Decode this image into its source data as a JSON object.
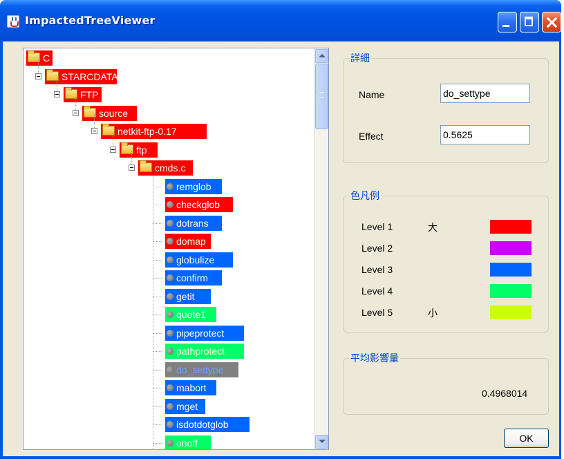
{
  "window": {
    "title": "ImpactedTreeViewer"
  },
  "colors": {
    "level1": "#ff0000",
    "level2": "#cc00ff",
    "level3": "#0066ff",
    "level4": "#00ff66",
    "level5": "#ccff00",
    "selected": "#808080",
    "selected_text": "#6fa0ff"
  },
  "tree": {
    "folders": [
      {
        "label": "C",
        "color": "level1"
      },
      {
        "label": "STARCDATA",
        "color": "level1"
      },
      {
        "label": "FTP",
        "color": "level1"
      },
      {
        "label": "source",
        "color": "level1"
      },
      {
        "label": "netkit-ftp-0.17",
        "color": "level1"
      },
      {
        "label": "ftp",
        "color": "level1"
      },
      {
        "label": "cmds.c",
        "color": "level1"
      }
    ],
    "leaves": [
      {
        "label": "remglob",
        "color": "level3"
      },
      {
        "label": "checkglob",
        "color": "level1"
      },
      {
        "label": "dotrans",
        "color": "level3"
      },
      {
        "label": "domap",
        "color": "level1"
      },
      {
        "label": "globulize",
        "color": "level3"
      },
      {
        "label": "confirm",
        "color": "level3"
      },
      {
        "label": "getit",
        "color": "level3"
      },
      {
        "label": "quote1",
        "color": "level4"
      },
      {
        "label": "pipeprotect",
        "color": "level3"
      },
      {
        "label": "pathprotect",
        "color": "level4"
      },
      {
        "label": "do_settype",
        "color": "selected",
        "selected": true
      },
      {
        "label": "mabort",
        "color": "level3"
      },
      {
        "label": "mget",
        "color": "level3"
      },
      {
        "label": "isdotdotglob",
        "color": "level3"
      },
      {
        "label": "onoff",
        "color": "level4"
      }
    ]
  },
  "details": {
    "title": "詳細",
    "name_label": "Name",
    "name_value": "do_settype",
    "effect_label": "Effect",
    "effect_value": "0.5625"
  },
  "legend": {
    "title": "色凡例",
    "items": [
      {
        "label": "Level 1",
        "note": "大",
        "color": "level1"
      },
      {
        "label": "Level 2",
        "note": "",
        "color": "level2"
      },
      {
        "label": "Level 3",
        "note": "",
        "color": "level3"
      },
      {
        "label": "Level 4",
        "note": "",
        "color": "level4"
      },
      {
        "label": "Level 5",
        "note": "小",
        "color": "level5"
      }
    ]
  },
  "average": {
    "title": "平均影響量",
    "value": "0.4968014"
  },
  "ok_label": "OK"
}
